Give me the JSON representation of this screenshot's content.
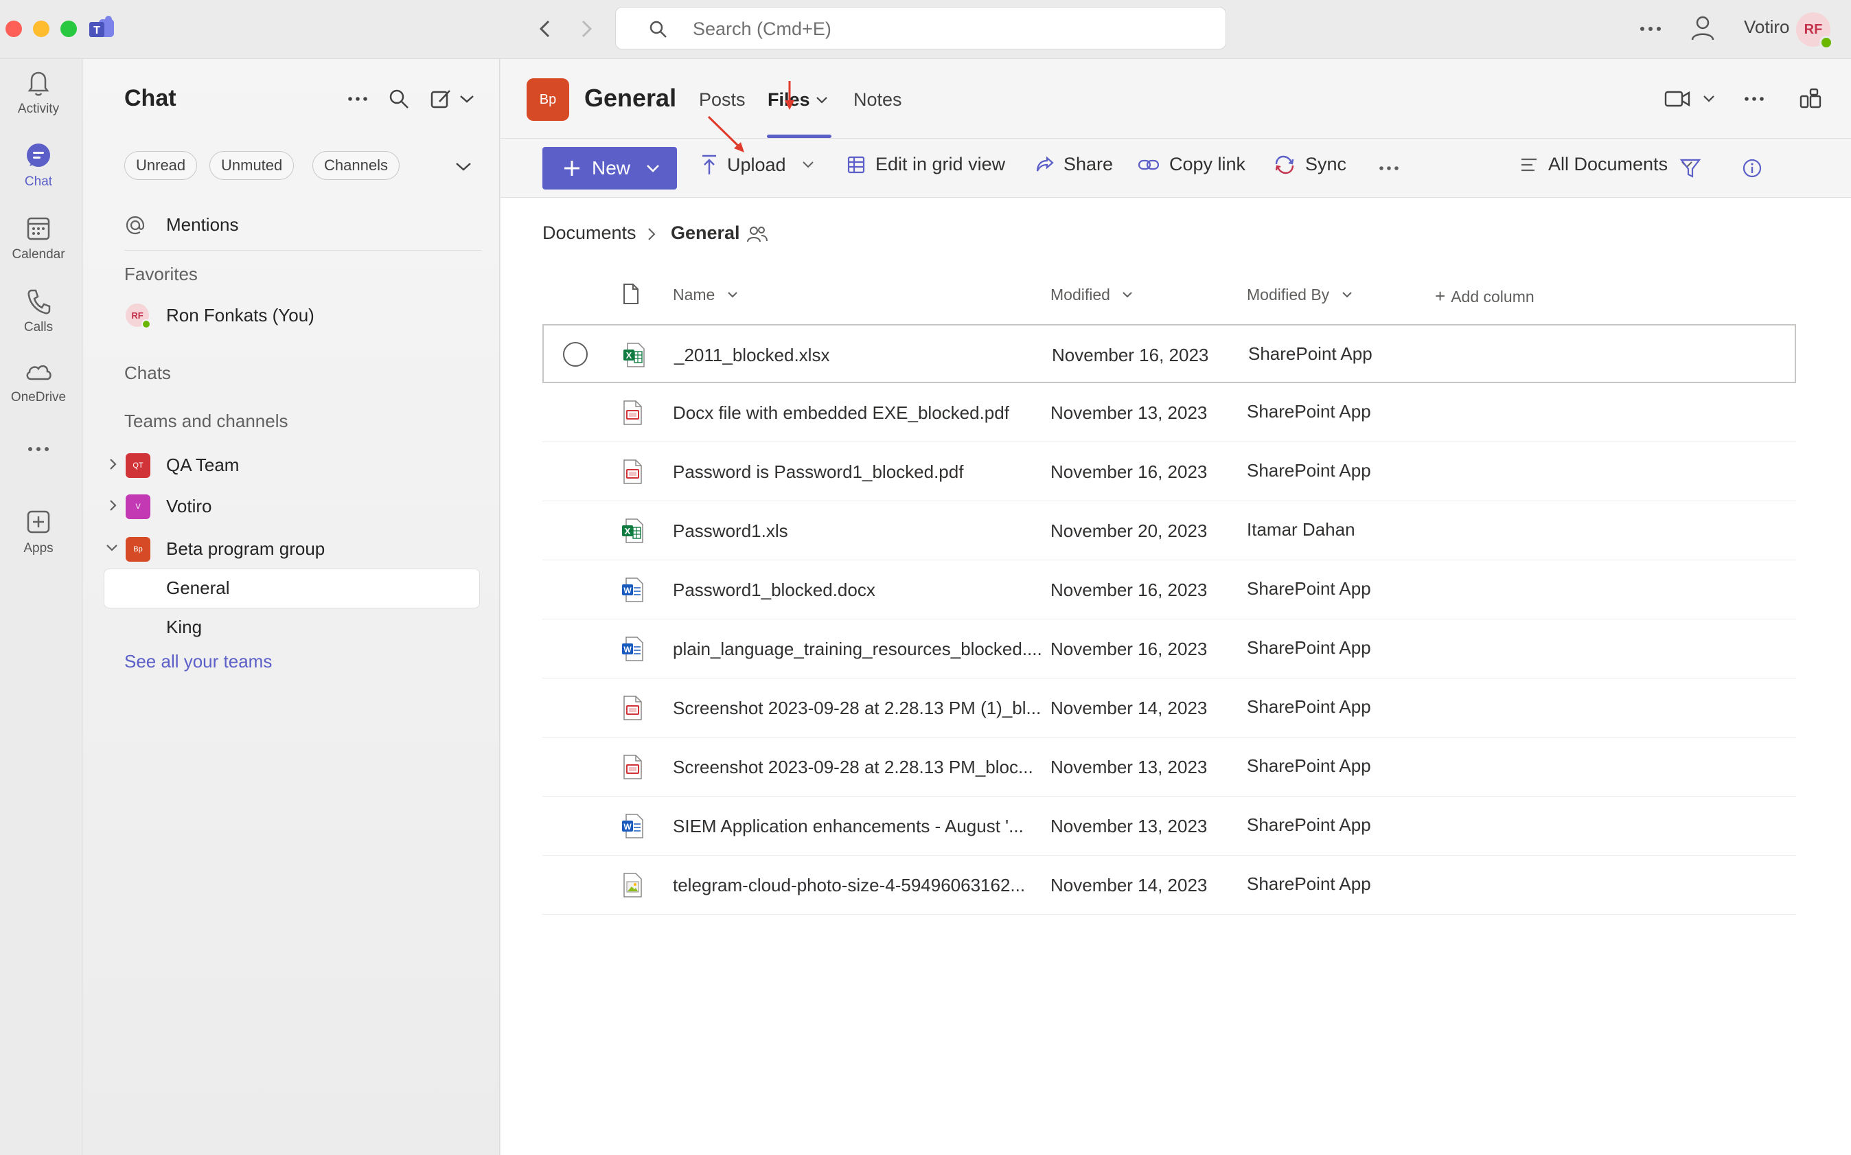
{
  "titlebar": {
    "search_placeholder": "Search (Cmd+E)",
    "org_name": "Votiro",
    "avatar_initials": "RF"
  },
  "rail": {
    "items": [
      {
        "label": "Activity",
        "icon": "bell-icon"
      },
      {
        "label": "Chat",
        "icon": "chat-icon"
      },
      {
        "label": "Calendar",
        "icon": "calendar-icon"
      },
      {
        "label": "Calls",
        "icon": "phone-icon"
      },
      {
        "label": "OneDrive",
        "icon": "cloud-icon"
      },
      {
        "label": "",
        "icon": "more-icon"
      },
      {
        "label": "Apps",
        "icon": "add-app-icon"
      }
    ]
  },
  "chat_pane": {
    "title": "Chat",
    "filters": [
      "Unread",
      "Unmuted",
      "Channels"
    ],
    "mentions": "Mentions",
    "favorites_header": "Favorites",
    "favorite_user": "Ron Fonkats (You)",
    "favorite_user_initials": "RF",
    "chats_header": "Chats",
    "teams_header": "Teams and channels",
    "teams": [
      {
        "name": "QA Team",
        "initials": "QT",
        "color": "#d13438",
        "expanded": false
      },
      {
        "name": "Votiro",
        "initials": "V",
        "color": "#c239b3",
        "expanded": false
      },
      {
        "name": "Beta program group",
        "initials": "Bp",
        "color": "#d74a26",
        "expanded": true
      }
    ],
    "channels": [
      "General",
      "King"
    ],
    "see_all": "See all your teams"
  },
  "channel": {
    "badge": "Bp",
    "name": "General",
    "tabs": [
      "Posts",
      "Files",
      "Notes"
    ],
    "active_tab": "Files"
  },
  "commands": {
    "new": "New",
    "upload": "Upload",
    "edit_grid": "Edit in grid view",
    "share": "Share",
    "copy_link": "Copy link",
    "sync": "Sync",
    "view": "All Documents"
  },
  "breadcrumb": {
    "root": "Documents",
    "current": "General"
  },
  "columns": {
    "name": "Name",
    "modified": "Modified",
    "modified_by": "Modified By",
    "add_column": "Add column"
  },
  "files": [
    {
      "name": "_2011_blocked.xlsx",
      "type": "excel",
      "modified": "November 16, 2023",
      "by": "SharePoint App"
    },
    {
      "name": "Docx file with embedded EXE_blocked.pdf",
      "type": "pdf",
      "modified": "November 13, 2023",
      "by": "SharePoint App"
    },
    {
      "name": "Password is Password1_blocked.pdf",
      "type": "pdf",
      "modified": "November 16, 2023",
      "by": "SharePoint App"
    },
    {
      "name": "Password1.xls",
      "type": "excel",
      "modified": "November 20, 2023",
      "by": "Itamar Dahan"
    },
    {
      "name": "Password1_blocked.docx",
      "type": "word",
      "modified": "November 16, 2023",
      "by": "SharePoint App"
    },
    {
      "name": "plain_language_training_resources_blocked....",
      "type": "word",
      "modified": "November 16, 2023",
      "by": "SharePoint App"
    },
    {
      "name": "Screenshot 2023-09-28 at 2.28.13 PM (1)_bl...",
      "type": "pdf",
      "modified": "November 14, 2023",
      "by": "SharePoint App"
    },
    {
      "name": "Screenshot 2023-09-28 at 2.28.13 PM_bloc...",
      "type": "pdf",
      "modified": "November 13, 2023",
      "by": "SharePoint App"
    },
    {
      "name": "SIEM Application enhancements - August '...",
      "type": "word",
      "modified": "November 13, 2023",
      "by": "SharePoint App"
    },
    {
      "name": "telegram-cloud-photo-size-4-59496063162...",
      "type": "image",
      "modified": "November 14, 2023",
      "by": "SharePoint App"
    }
  ],
  "colors": {
    "accent": "#5b5fc7",
    "annotation": "#e03c2d"
  }
}
